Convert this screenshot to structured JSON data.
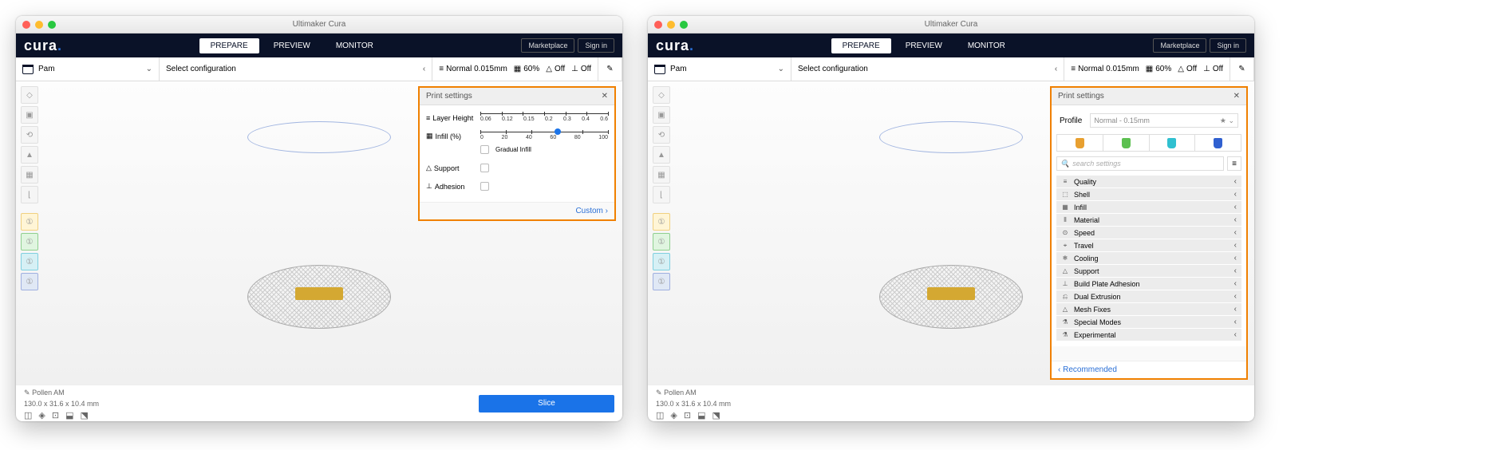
{
  "window_title": "Ultimaker Cura",
  "logo": "cura",
  "nav": {
    "prepare": "PREPARE",
    "preview": "PREVIEW",
    "monitor": "MONITOR"
  },
  "header_buttons": {
    "marketplace": "Marketplace",
    "signin": "Sign in"
  },
  "subbar": {
    "file": "Pam",
    "config": "Select configuration",
    "profile": "Normal 0.015mm",
    "infill": "60%",
    "support_label": "Off",
    "adhesion_label": "Off"
  },
  "panel_simple": {
    "title": "Print settings",
    "layer_height_label": "Layer Height",
    "layer_ticks": [
      "0.06",
      "0.12",
      "0.15",
      "0.2",
      "0.3",
      "0.4",
      "0.6"
    ],
    "infill_label": "Infill (%)",
    "infill_ticks": [
      "0",
      "20",
      "40",
      "60",
      "80",
      "100"
    ],
    "infill_value": 60,
    "gradual_infill": "Gradual Infill",
    "support": "Support",
    "adhesion": "Adhesion",
    "custom": "Custom  ›"
  },
  "panel_custom": {
    "title": "Print settings",
    "profile_label": "Profile",
    "profile_value": "Normal - 0.15mm",
    "search_placeholder": "search settings",
    "categories": [
      {
        "icon": "≡",
        "label": "Quality"
      },
      {
        "icon": "⬚",
        "label": "Shell"
      },
      {
        "icon": "▦",
        "label": "Infill"
      },
      {
        "icon": "⦀",
        "label": "Material"
      },
      {
        "icon": "⊙",
        "label": "Speed"
      },
      {
        "icon": "⌖",
        "label": "Travel"
      },
      {
        "icon": "❄",
        "label": "Cooling"
      },
      {
        "icon": "△",
        "label": "Support"
      },
      {
        "icon": "⊥",
        "label": "Build Plate Adhesion"
      },
      {
        "icon": "⎌",
        "label": "Dual Extrusion"
      },
      {
        "icon": "△",
        "label": "Mesh Fixes"
      },
      {
        "icon": "⚗",
        "label": "Special Modes"
      },
      {
        "icon": "⚗",
        "label": "Experimental"
      }
    ],
    "recommended": "‹  Recommended"
  },
  "bottom": {
    "model_name": "Pollen AM",
    "dimensions": "130.0 x 31.6 x 10.4 mm"
  },
  "slice": "Slice"
}
